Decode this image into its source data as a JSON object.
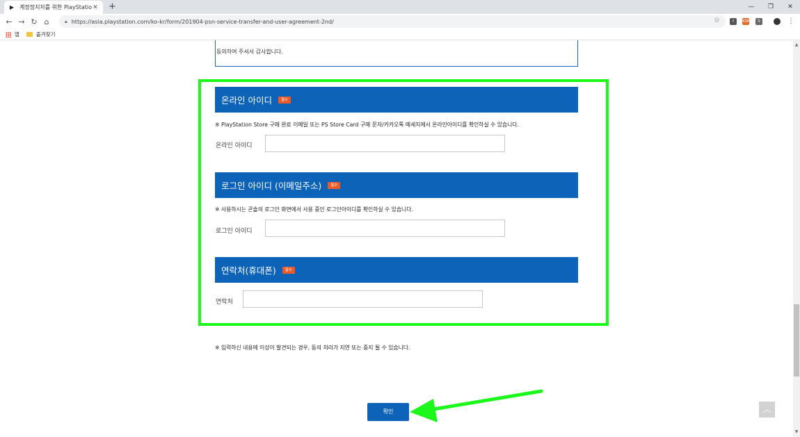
{
  "browser": {
    "tab_title": "계정정지자를 위한 PlayStation N",
    "url": "https://asia.playstation.com/ko-kr/form/201904-psn-service-transfer-and-user-agreement-2nd/",
    "bookmarks": [
      "앱",
      "즐겨찾기"
    ],
    "extensions": [
      {
        "label": "I",
        "color": "#555555"
      },
      {
        "label": "KW",
        "color": "#e86a2a"
      },
      {
        "label": "S",
        "color": "#666666"
      }
    ]
  },
  "notice": {
    "text": "동의하여 주셔서 감사합니다."
  },
  "sections": [
    {
      "title": "온라인 아이디",
      "badge": "필수",
      "hint": "※ PlayStation Store 구매 완료 이메일 또는 PS Store Card 구매 문자/카카오톡 메세지에서 온라인아이디를 확인하실 수 있습니다.",
      "field_label": "온라인 아이디",
      "field_value": ""
    },
    {
      "title": "로그인 아이디 (이메일주소)",
      "badge": "필수",
      "hint": "※ 사용하시는 콘솔의 로그인 화면에서 사용 중인 로그인아이디를 확인하실 수 있습니다.",
      "field_label": "로그인 아이디",
      "field_value": ""
    },
    {
      "title": "연락처(휴대폰)",
      "badge": "필수",
      "field_label": "연락처",
      "field_value": ""
    }
  ],
  "footnote": "※ 입력하신 내용에 이상이 발견되는 경우, 동의 처리가 지연 또는 중지 될 수 있습니다.",
  "confirm_label": "확인",
  "colors": {
    "header_blue": "#0d63b7",
    "badge_orange": "#ec5a27",
    "highlight_green": "#1cf81c"
  }
}
